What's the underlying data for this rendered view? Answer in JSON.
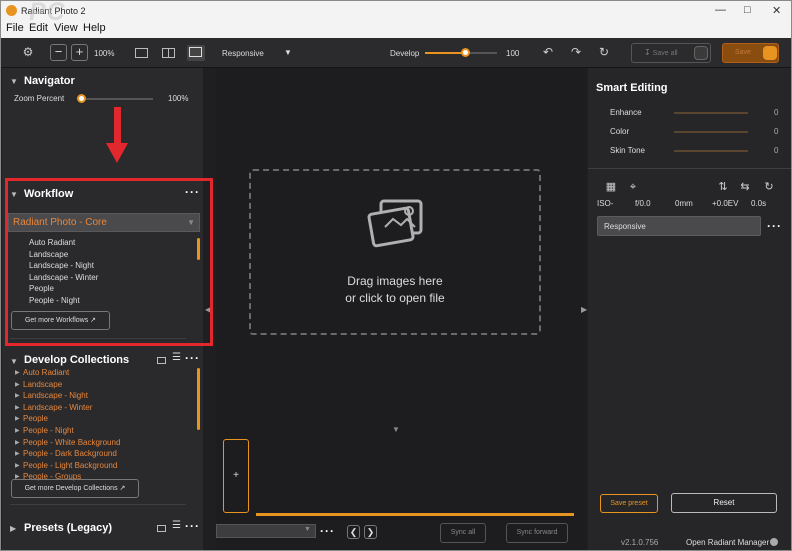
{
  "window": {
    "title": "Radiant Photo 2",
    "watermark": "PC"
  },
  "menu": [
    "File",
    "Edit",
    "View",
    "Help"
  ],
  "toolbar": {
    "zoom": "100%",
    "preview_mode": "Responsive",
    "develop_label": "Develop",
    "develop_value": "100",
    "develop_level": 0.55,
    "save_all": "Save all",
    "save": "Save"
  },
  "navigator": {
    "title": "Navigator",
    "zoom_label": "Zoom Percent",
    "zoom_value": "100%",
    "zoom_level": 0.05
  },
  "workflow": {
    "title": "Workflow",
    "selected": "Radiant Photo - Core",
    "items": [
      "Auto Radiant",
      "Landscape",
      "Landscape - Night",
      "Landscape - Winter",
      "People",
      "People - Night"
    ],
    "more": "Get more Workflows"
  },
  "collections": {
    "title": "Develop Collections",
    "items": [
      "Auto Radiant",
      "Landscape",
      "Landscape - Night",
      "Landscape - Winter",
      "People",
      "People - Night",
      "People - White Background",
      "People - Dark Background",
      "People - Light Background",
      "People - Groups"
    ],
    "more": "Get more Develop Collections"
  },
  "presets": {
    "title": "Presets (Legacy)"
  },
  "canvas": {
    "drop_line1": "Drag images here",
    "drop_line2": "or click to open file",
    "add": "+",
    "sync_all": "Sync all",
    "sync_forward": "Sync forward"
  },
  "smart": {
    "title": "Smart Editing",
    "sliders": [
      {
        "label": "Enhance",
        "value": "0"
      },
      {
        "label": "Color",
        "value": "0"
      },
      {
        "label": "Skin Tone",
        "value": "0"
      }
    ],
    "exif": [
      "ISO-",
      "f/0.0",
      "0mm",
      "+0.0EV",
      "0.0s"
    ],
    "preset": "Responsive",
    "save_preset": "Save preset",
    "reset": "Reset",
    "version": "v2.1.0.756",
    "manager": "Open Radiant Manager"
  },
  "colors": {
    "accent": "#e89420",
    "highlight": "#e2282c"
  }
}
